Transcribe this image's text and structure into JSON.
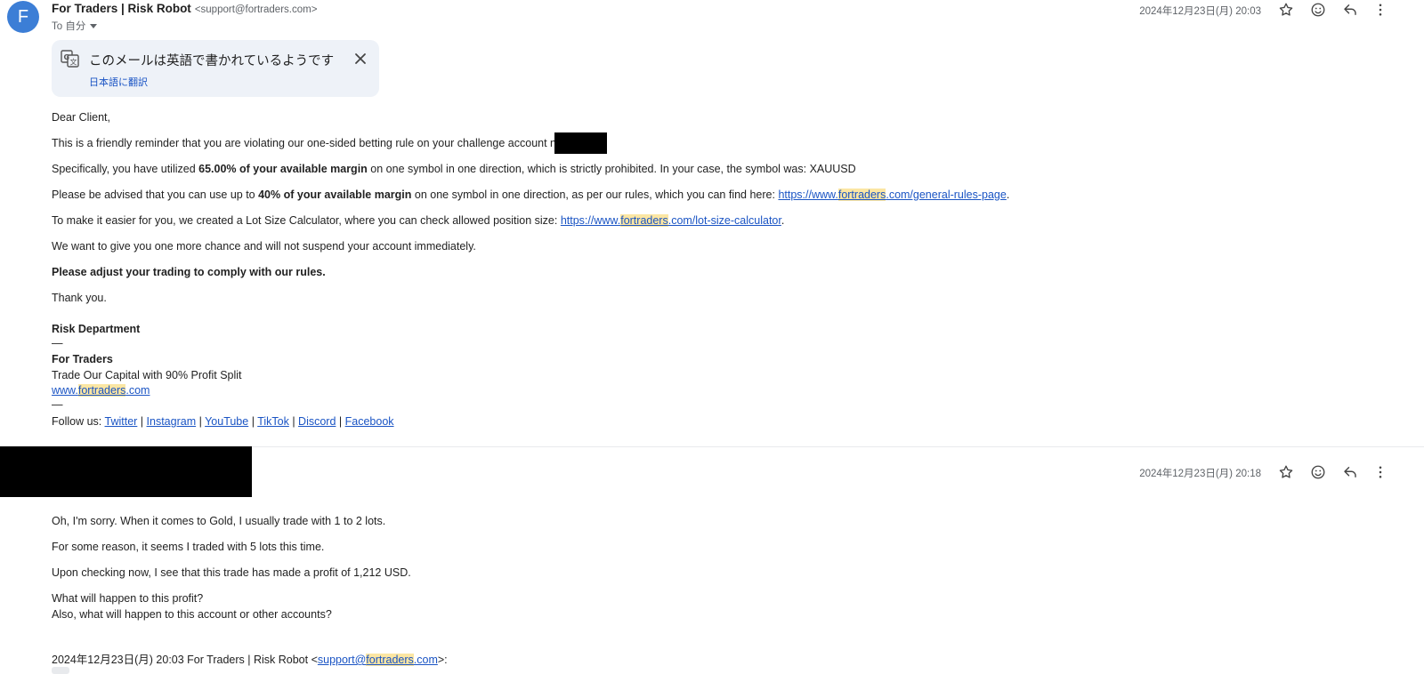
{
  "email1": {
    "avatar_letter": "F",
    "sender_name": "For Traders | Risk Robot",
    "sender_email": "<support@fortraders.com>",
    "to_label": "To 自分",
    "date": "2024年12月23日(月) 20:03",
    "translate": {
      "title": "このメールは英語で書かれているようです",
      "link": "日本語に翻訳"
    },
    "body": {
      "greeting": "Dear Client,",
      "p1": "This is a friendly reminder that you are violating our one-sided betting rule on your challenge account number:",
      "p2_a": "Specifically, you have utilized ",
      "p2_b": "65.00% of your available margin",
      "p2_c": " on one symbol in one direction, which is strictly prohibited. In your case, the symbol was: XAUUSD",
      "p3_a": "Please be advised that you can use up to ",
      "p3_b": "40% of your available margin",
      "p3_c": " on one symbol in one direction, as per our rules, which you can find here: ",
      "p3_link_a": "https://www.",
      "p3_link_hl": "fortraders",
      "p3_link_b": ".com/general-rules-page",
      "p3_end": ".",
      "p4_a": "To make it easier for you, we created a Lot Size Calculator, where you can check allowed position size: ",
      "p4_link_a": "https://www.",
      "p4_link_hl": "fortraders",
      "p4_link_b": ".com/lot-size-calculator",
      "p4_end": ".",
      "p5": "We want to give you one more chance and will not suspend your account immediately.",
      "p6": "Please adjust your trading to comply with our rules.",
      "p7": "Thank you."
    },
    "signature": {
      "dept": "Risk Department",
      "dash": "—",
      "company": "For Traders",
      "tagline": "Trade Our Capital with 90% Profit Split",
      "site_a": "www.",
      "site_hl": "fortraders",
      "site_b": ".com",
      "follow_label": "Follow us: ",
      "sep": " | ",
      "social": [
        "Twitter",
        "Instagram",
        "YouTube",
        "TikTok",
        "Discord",
        "Facebook"
      ]
    }
  },
  "email2": {
    "date": "2024年12月23日(月) 20:18",
    "lines": [
      "Oh, I'm sorry. When it comes to Gold, I usually trade with 1 to 2 lots.",
      "For some reason, it seems I traded with 5 lots this time.",
      "Upon checking now, I see that this trade has made a profit of 1,212 USD.",
      "What will happen to this profit?",
      "Also, what will happen to this account or other accounts?"
    ],
    "quote": {
      "prefix": "2024年12月23日(月) 20:03 For Traders | Risk Robot <",
      "link_a": "support@",
      "link_hl": "fortraders",
      "link_b": ".com",
      "suffix": ">:"
    }
  }
}
